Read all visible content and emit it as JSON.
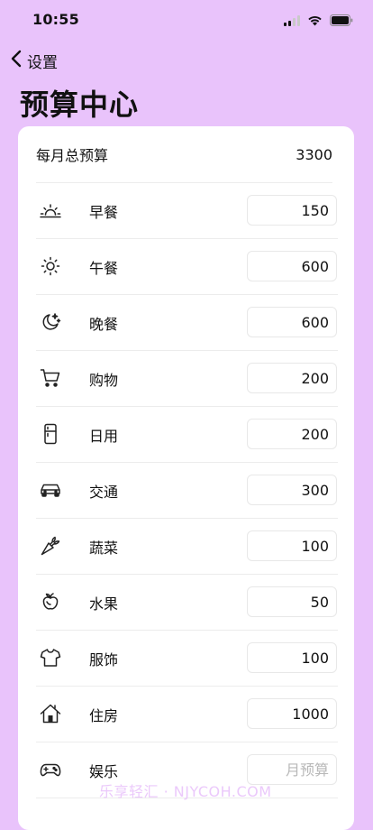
{
  "status": {
    "time": "10:55",
    "icons": [
      "signal-icon",
      "wifi-icon",
      "battery-icon"
    ]
  },
  "nav": {
    "back_label": "设置",
    "back_icon": "chevron-left-icon"
  },
  "title": "预算中心",
  "total": {
    "label": "每月总预算",
    "value": "3300"
  },
  "categories": [
    {
      "label": "早餐",
      "value": "150",
      "icon": "sunrise-icon"
    },
    {
      "label": "午餐",
      "value": "600",
      "icon": "sun-icon"
    },
    {
      "label": "晚餐",
      "value": "600",
      "icon": "moon-stars-icon"
    },
    {
      "label": "购物",
      "value": "200",
      "icon": "cart-icon"
    },
    {
      "label": "日用",
      "value": "200",
      "icon": "refrigerator-icon"
    },
    {
      "label": "交通",
      "value": "300",
      "icon": "car-icon"
    },
    {
      "label": "蔬菜",
      "value": "100",
      "icon": "carrot-icon"
    },
    {
      "label": "水果",
      "value": "50",
      "icon": "fruit-icon"
    },
    {
      "label": "服饰",
      "value": "100",
      "icon": "tshirt-icon"
    },
    {
      "label": "住房",
      "value": "1000",
      "icon": "house-icon"
    },
    {
      "label": "娱乐",
      "value": "",
      "placeholder": "月预算",
      "icon": "gamepad-icon"
    }
  ],
  "watermark": "乐享轻汇 · NJYCOH.COM",
  "colors": {
    "background": "#e9c3fb",
    "card": "#ffffff",
    "text": "#111111",
    "placeholder": "#b8b8b8"
  }
}
